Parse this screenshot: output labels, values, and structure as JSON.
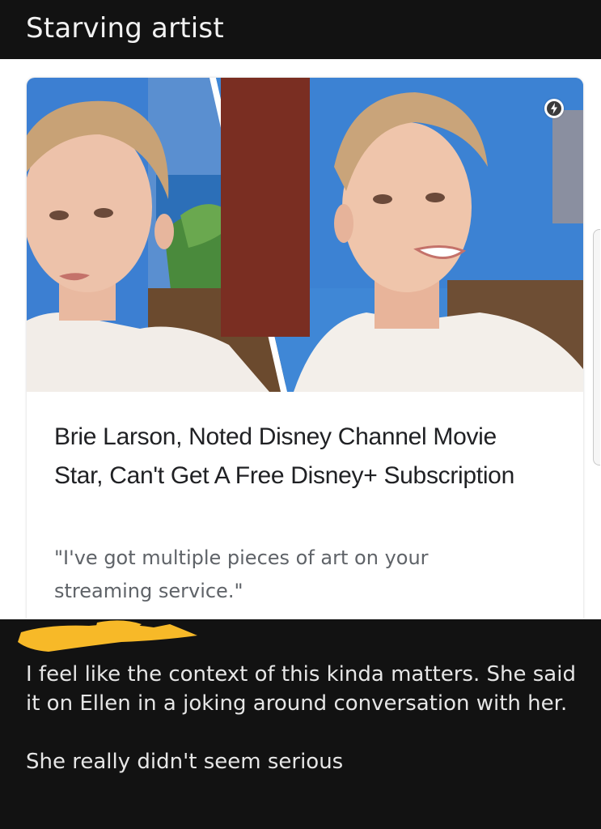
{
  "post": {
    "title": "Starving artist"
  },
  "card": {
    "headline": "Brie Larson, Noted Disney Channel Movie Star, Can't Get A Free Disney+ Subscription",
    "snippet": "\"I've got multiple pieces of art on your streaming service.\"",
    "badge_icon": "lightning-bolt-icon"
  },
  "comment": {
    "username_redaction": "yellow-scribble",
    "paragraph_1": "I feel like the context of this kinda matters. She said it on Ellen in a joking around conversation with her.",
    "paragraph_2": "She really didn't seem serious"
  },
  "colors": {
    "dark_background": "#121212",
    "card_text": "#202124",
    "snippet_text": "#5f6368",
    "comment_text": "#e6e6e6",
    "redaction_yellow": "#f7b928",
    "studio_blue": "#2f76c8"
  }
}
